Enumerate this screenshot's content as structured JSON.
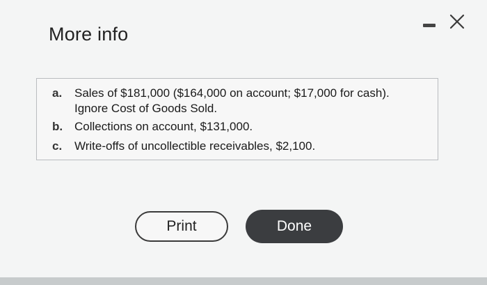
{
  "dialog": {
    "title": "More info",
    "minimize_icon": "minimize-icon",
    "close_icon": "close-icon"
  },
  "items": [
    {
      "marker": "a.",
      "lines": [
        "Sales of $181,000 ($164,000 on account; $17,000 for cash).",
        "Ignore Cost of Goods Sold."
      ]
    },
    {
      "marker": "b.",
      "lines": [
        "Collections on account, $131,000."
      ]
    },
    {
      "marker": "c.",
      "lines": [
        "Write-offs of uncollectible receivables, $2,100."
      ]
    }
  ],
  "buttons": {
    "print_label": "Print",
    "done_label": "Done"
  },
  "colors": {
    "done_bg": "#3b3d40",
    "text": "#1a1a1a"
  }
}
